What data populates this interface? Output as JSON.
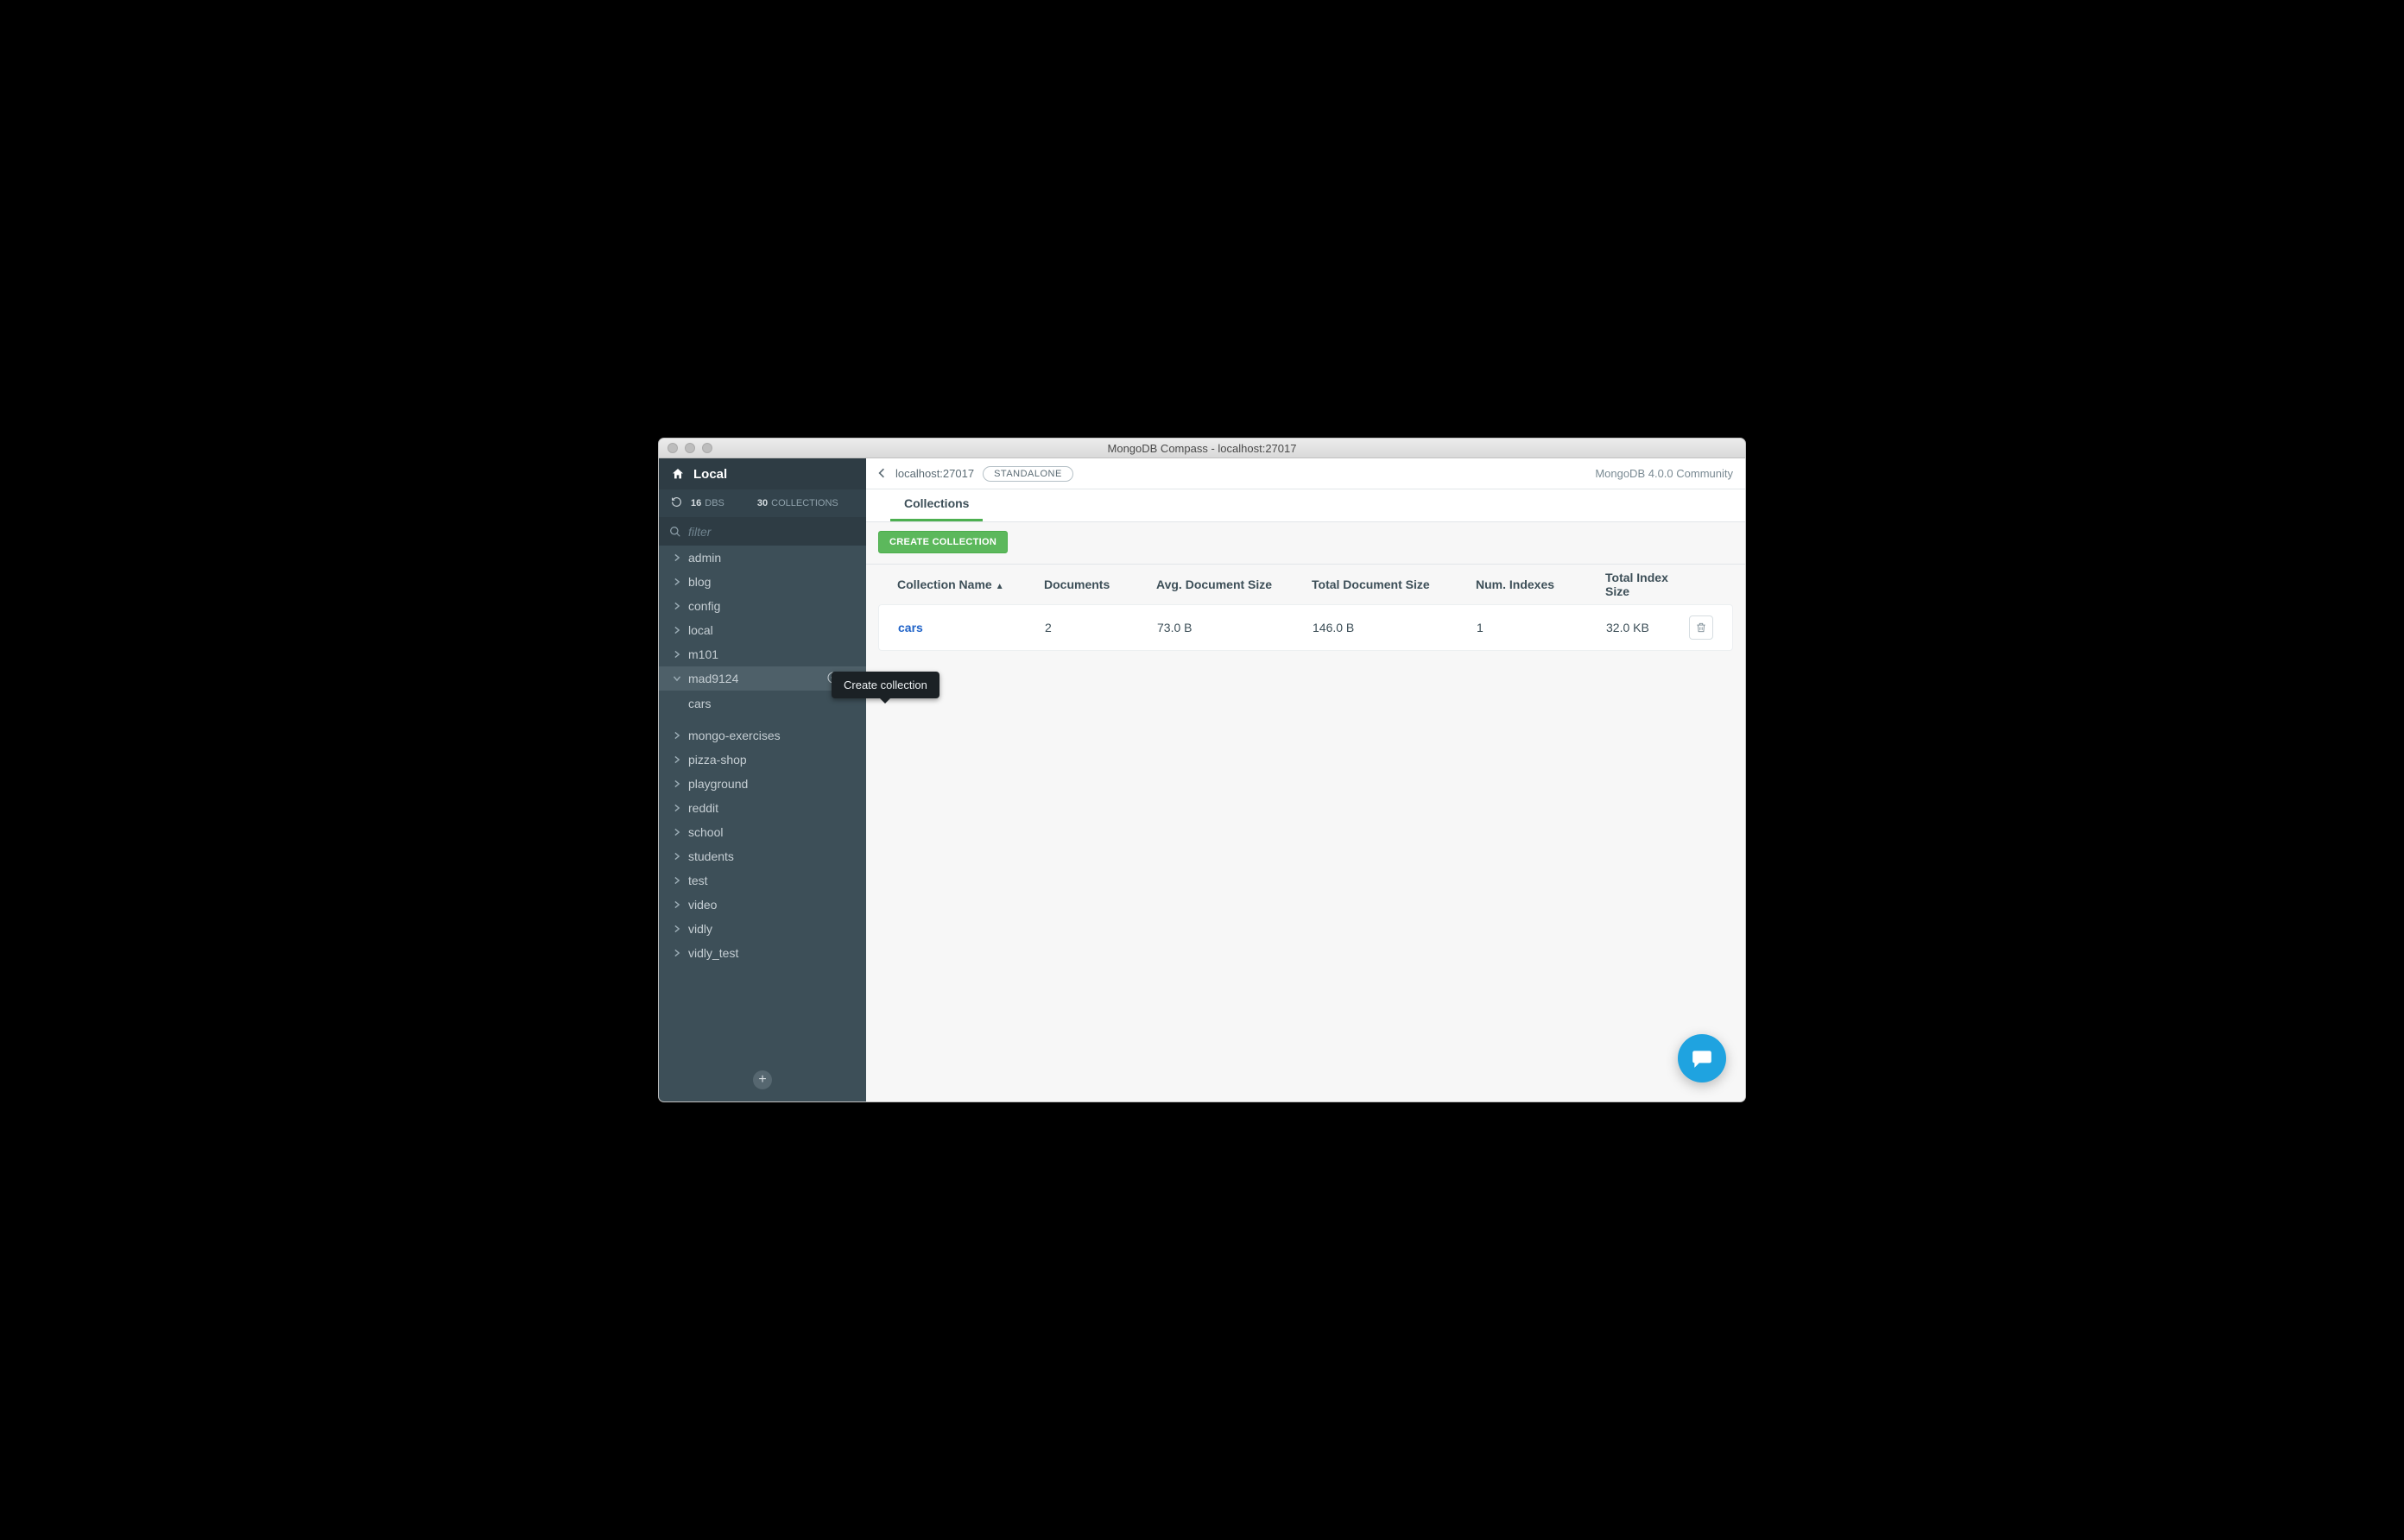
{
  "window": {
    "title": "MongoDB Compass - localhost:27017"
  },
  "sidebar": {
    "title": "Local",
    "stats": {
      "db_count": "16",
      "db_label": "DBS",
      "coll_count": "30",
      "coll_label": "COLLECTIONS"
    },
    "filter_placeholder": "filter",
    "databases": [
      {
        "name": "admin",
        "expanded": false
      },
      {
        "name": "blog",
        "expanded": false
      },
      {
        "name": "config",
        "expanded": false
      },
      {
        "name": "local",
        "expanded": false
      },
      {
        "name": "m101",
        "expanded": false
      },
      {
        "name": "mad9124",
        "expanded": true,
        "collections": [
          {
            "name": "cars"
          }
        ]
      },
      {
        "name": "mongo-exercises",
        "expanded": false
      },
      {
        "name": "pizza-shop",
        "expanded": false
      },
      {
        "name": "playground",
        "expanded": false
      },
      {
        "name": "reddit",
        "expanded": false
      },
      {
        "name": "school",
        "expanded": false
      },
      {
        "name": "students",
        "expanded": false
      },
      {
        "name": "test",
        "expanded": false
      },
      {
        "name": "video",
        "expanded": false
      },
      {
        "name": "vidly",
        "expanded": false
      },
      {
        "name": "vidly_test",
        "expanded": false
      }
    ],
    "tooltip": "Create collection"
  },
  "topbar": {
    "breadcrumb": "localhost:27017",
    "badge": "STANDALONE",
    "version": "MongoDB 4.0.0 Community"
  },
  "tabs": {
    "active": "Collections"
  },
  "actions": {
    "create_collection": "CREATE COLLECTION"
  },
  "table": {
    "headers": {
      "name": "Collection Name",
      "docs": "Documents",
      "avg": "Avg. Document Size",
      "total": "Total Document Size",
      "idx": "Num. Indexes",
      "idxsize": "Total Index Size"
    },
    "rows": [
      {
        "name": "cars",
        "docs": "2",
        "avg": "73.0 B",
        "total": "146.0 B",
        "idx": "1",
        "idxsize": "32.0 KB"
      }
    ]
  }
}
